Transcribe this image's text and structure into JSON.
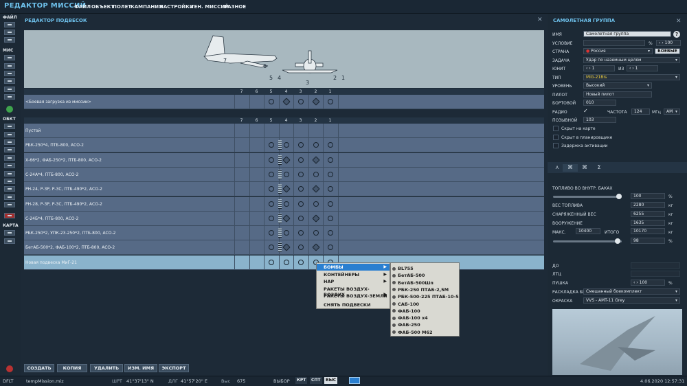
{
  "app": {
    "title": "РЕДАКТОР МИССИЙ",
    "menu": [
      "ФАЙЛ",
      "ОБЪЕКТ",
      "ПОЛЕТ",
      "КАМПАНИЯ",
      "НАСТРОЙКИ",
      "ГЕН. МИССИЙ",
      "РАЗНОЕ"
    ]
  },
  "leftbar": {
    "sections": [
      "ФАЙЛ",
      "МИС",
      "ОБКТ",
      "КАРТА"
    ]
  },
  "editor": {
    "title": "РЕДАКТОР ПОДВЕСОК",
    "pylon_numbers": [
      "7",
      "6",
      "5",
      "4",
      "3",
      "2",
      "1"
    ],
    "mission_row": {
      "label": "<Боевая загрузка из миссии>"
    },
    "loadouts": [
      "Пустой",
      "РБК-250*4, ПТБ-800, АСО-2",
      "Х-66*2, ФАБ-250*2, ПТБ-800, АСО-2",
      "С-24А*4, ПТБ-800, АСО-2",
      "РН-24, Р-3Р, Р-3С, ПТБ-490*2, АСО-2",
      "РН-28, Р-3Р, Р-3С, ПТБ-490*2, АСО-2",
      "С-24Б*4, ПТБ-800, АСО-2",
      "РБК-250*2, УПК-23-250*2, ПТБ-800, АСО-2",
      "БетАБ-500*2, ФАБ-100*2, ПТБ-800, АСО-2",
      "Новая подвеска МиГ-21"
    ],
    "buttons": [
      "СОЗДАТЬ",
      "КОПИЯ",
      "УДАЛИТЬ",
      "ИЗМ. ИМЯ",
      "ЭКСПОРТ"
    ]
  },
  "context_menu": {
    "items": [
      {
        "label": "БОМБЫ",
        "has_sub": true,
        "highlighted": true
      },
      {
        "label": "КОНТЕЙНЕРЫ",
        "has_sub": true
      },
      {
        "label": "НАР",
        "has_sub": true
      },
      {
        "label": "РАКЕТЫ ВОЗДУХ-ВОЗДУХ",
        "has_sub": true
      },
      {
        "label": "РАКЕТЫ ВОЗДУХ-ЗЕМЛЯ",
        "has_sub": true
      },
      {
        "label": "СНЯТЬ ПОДВЕСКИ",
        "has_sub": false
      }
    ],
    "submenu": [
      "BL755",
      "БетАБ-500",
      "БетАБ-500Шп",
      "РБК-250 ПТАБ-2,5М",
      "РБК-500-225 ПТАБ-10-5",
      "САБ-100",
      "ФАБ-100",
      "ФАБ-100 x4",
      "ФАБ-250",
      "ФАБ-500 М62"
    ]
  },
  "group": {
    "title": "САМОЛЕТНАЯ ГРУППА",
    "help": "?",
    "labels": {
      "name": "ИМЯ",
      "condition": "УСЛОВИЕ",
      "country": "СТРАНА",
      "task": "ЗАДАЧА",
      "unit": "ЮНИТ",
      "of": "ИЗ",
      "type": "ТИП",
      "skill": "УРОВЕНЬ",
      "pilot": "ПИЛОТ",
      "board": "БОРТОВОЙ",
      "radio": "РАДИО",
      "freq": "ЧАСТОТА",
      "freq_unit": "МГц",
      "callsign": "ПОЗЫВНОЙ"
    },
    "name": "Самолетная группа",
    "condition_pct": "%",
    "condition_value": "100",
    "country": "Россия",
    "combat_button": "БОЕВЫЕ",
    "task": "Удар по наземным целям",
    "unit": "1",
    "unit_of": "1",
    "type": "MiG-21Bis",
    "skill": "Высокий",
    "pilot": "Новый пилот",
    "board": "010",
    "radio_check": "✓",
    "frequency": "124",
    "modulation": "AM",
    "callsign": "103",
    "checks": [
      "Скрыт на карте",
      "Скрыт в планировщике",
      "Задержка активации"
    ]
  },
  "payload_tab": {
    "tabs": [
      "⋏",
      "⌘",
      "⌘",
      "Σ"
    ],
    "fuel_label": "ТОПЛИВО ВО ВНУТР. БАКАХ",
    "fuel_pct": "100",
    "fuel_fraction": 1.0,
    "fuel_weight_label": "ВЕС ТОПЛИВА",
    "fuel_weight": "2280",
    "empty_weight_label": "СНАРЯЖЕННЫЙ ВЕС",
    "empty_weight": "6255",
    "armament_label": "ВООРУЖЕНИЕ",
    "armament": "1635",
    "max_label": "МАКС.",
    "max": "10400",
    "total_label": "ИТОГО",
    "total": "10170",
    "load_pct": "98",
    "load_fraction": 0.98,
    "kg": "кг",
    "pct": "%",
    "do_label": "ДО",
    "ltc_label": "ЛТЦ",
    "gun_label": "ПУШКА",
    "gun_value": "100",
    "ammo_label": "РАСКЛАДКА БК",
    "ammo": "Смешанный боекомплект",
    "paint_label": "ОКРАСКА",
    "paint": "VVS - AMT-11 Grey"
  },
  "status": {
    "mode": "DFLT",
    "file": "tempMission.miz",
    "lat_label": "ШРТ",
    "lat": "41°37'13\" N",
    "lon_label": "ДЛГ",
    "lon": "41°57'20\" E",
    "alt_label": "Выс",
    "alt": "675",
    "select_label": "ВЫБОР",
    "btns": [
      "КРТ",
      "СПТ",
      "ВЫС"
    ],
    "datetime": "4.06.2020 12:57:31"
  }
}
